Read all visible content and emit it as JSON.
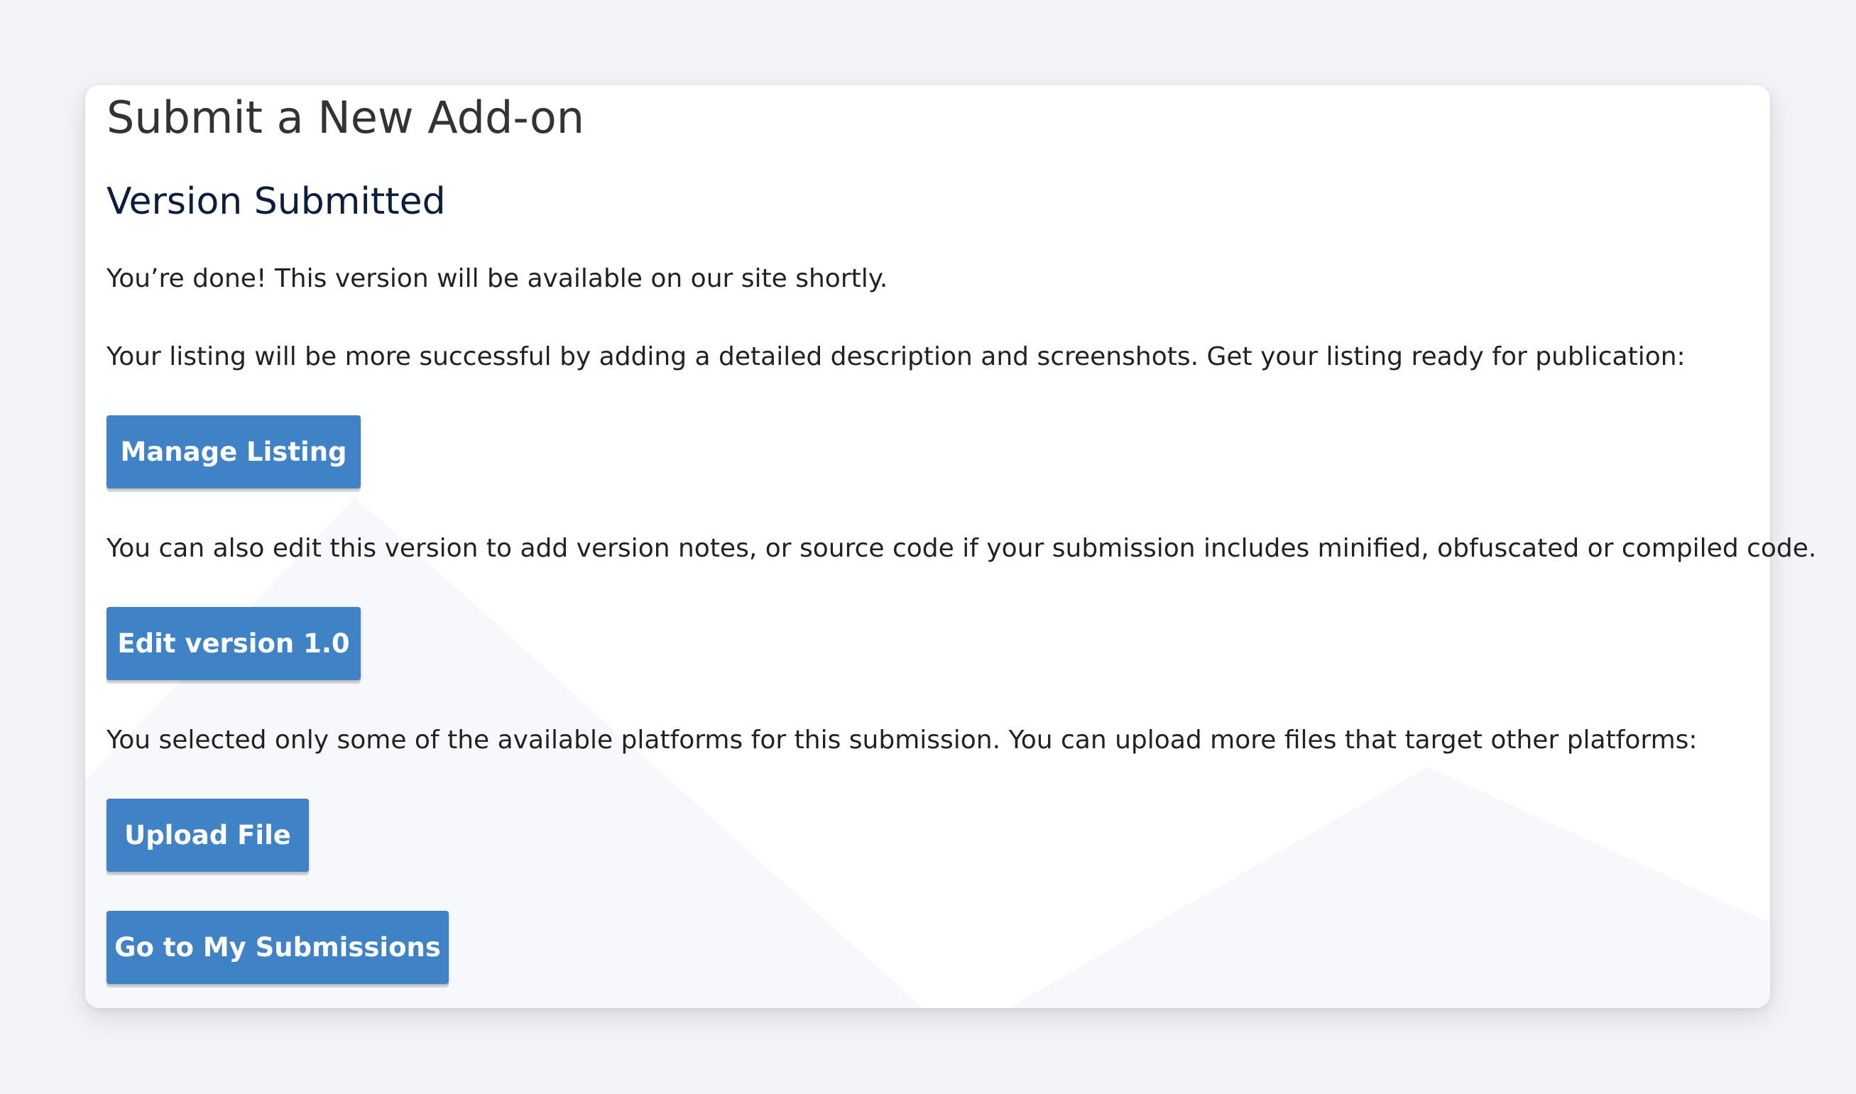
{
  "page": {
    "title": "Submit a New Add-on",
    "section_title": "Version Submitted"
  },
  "messages": {
    "done": "You’re done! This version will be available on our site shortly.",
    "listing_hint": "Your listing will be more successful by adding a detailed description and screenshots. Get your listing ready for publication:",
    "edit_hint": "You can also edit this version to add version notes, or source code if your submission includes minified, obfuscated or compiled code.",
    "platforms_hint": "You selected only some of the available platforms for this submission. You can upload more files that target other platforms:"
  },
  "buttons": {
    "manage_listing": "Manage Listing",
    "edit_version": "Edit version 1.0",
    "upload_file": "Upload File",
    "my_submissions": "Go to My Submissions"
  },
  "colors": {
    "button": "#3f82c6",
    "background": "#f3f4f8"
  }
}
